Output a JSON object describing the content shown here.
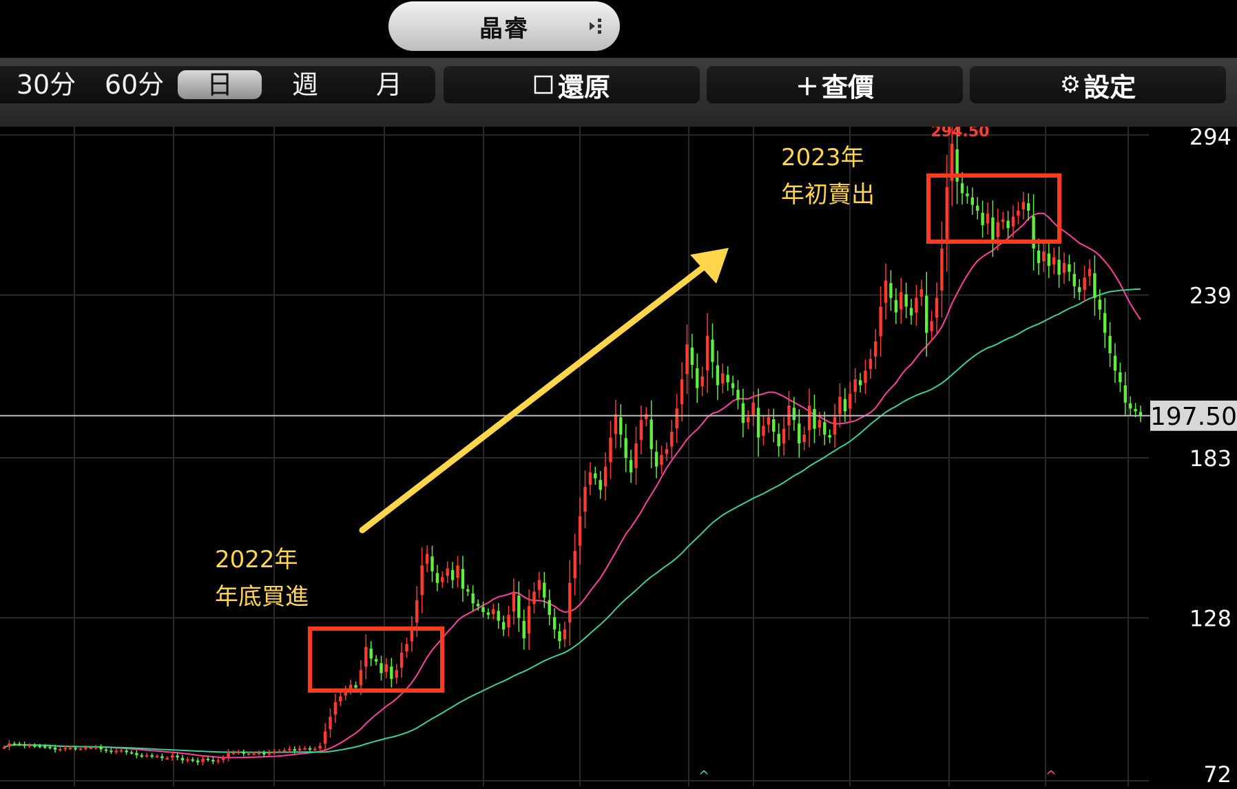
{
  "header": {
    "stock_name": "晶睿"
  },
  "toolbar": {
    "periods": [
      "30分",
      "60分",
      "日",
      "週",
      "月"
    ],
    "selected_period": "日",
    "restore_label": "還原",
    "add_quote_label": "查價",
    "settings_label": "設定"
  },
  "icons": {
    "menu": "kebab-menu-icon",
    "restore": "checkbox-icon",
    "add_quote": "plus-icon",
    "settings": "gear-icon"
  },
  "colors": {
    "up": "#ff3b30",
    "down": "#5ef03c",
    "ma_short": "#ff3ea5",
    "ma_long": "#34d399",
    "annotation": "#ffd54a",
    "box": "#ff3b1e",
    "price_line": "#bdbdbd",
    "grid": "#2a2a2a"
  },
  "chart_data": {
    "type": "candlestick",
    "y_ticks": [
      "294",
      "239",
      "183",
      "128",
      "72"
    ],
    "ylim": [
      72,
      294.5
    ],
    "current_price": "197.50",
    "high_label": "294.50",
    "annotations": [
      {
        "name": "buy",
        "lines": [
          "2022年",
          "年底買進"
        ]
      },
      {
        "name": "sell",
        "lines": [
          "2023年",
          "年初賣出"
        ]
      }
    ],
    "close": [
      83.5,
      84.8,
      84.7,
      84.6,
      84.0,
      84.2,
      84.0,
      83.9,
      83.7,
      83.5,
      82.7,
      82.9,
      83.3,
      83.3,
      83.1,
      83.1,
      83.4,
      83.4,
      83.6,
      82.8,
      82.4,
      82.0,
      82.3,
      82.5,
      81.8,
      81.7,
      80.8,
      80.6,
      80.8,
      80.5,
      80.5,
      79.8,
      79.8,
      80.8,
      80.0,
      79.0,
      79.4,
      79.1,
      78.3,
      79.6,
      79.3,
      78.6,
      79.0,
      79.8,
      81.5,
      81.7,
      81.9,
      81.3,
      81.4,
      81.4,
      81.6,
      81.0,
      81.7,
      82.1,
      82.2,
      82.5,
      83.0,
      82.3,
      83.1,
      83.2,
      82.9,
      83.0,
      84.0,
      89.0,
      94.0,
      99.0,
      101.0,
      103.0,
      105.0,
      104.0,
      110.0,
      118.0,
      114.0,
      113.0,
      109.0,
      112.0,
      107.0,
      110.0,
      116.0,
      119.0,
      125.0,
      134.0,
      146.0,
      150.0,
      144.0,
      140.0,
      142.0,
      145.0,
      141.0,
      146.0,
      138.0,
      137.0,
      133.0,
      132.0,
      130.0,
      129.0,
      131.0,
      127.0,
      124.0,
      129.0,
      137.0,
      128.0,
      121.0,
      132.0,
      137.0,
      141.0,
      135.0,
      129.0,
      124.0,
      120.0,
      124.0,
      140.0,
      151.0,
      163.0,
      173.0,
      178.0,
      176.0,
      172.0,
      180.0,
      190.0,
      198.0,
      191.0,
      183.0,
      178.0,
      188.0,
      196.0,
      198.0,
      186.0,
      180.0,
      184.0,
      186.0,
      192.0,
      200.0,
      210.0,
      222.0,
      215.0,
      207.0,
      211.0,
      225.0,
      216.0,
      208.0,
      212.0,
      209.0,
      207.0,
      203.0,
      195.0,
      197.0,
      202.0,
      190.0,
      194.0,
      197.0,
      192.0,
      187.0,
      193.0,
      201.0,
      196.0,
      188.0,
      191.0,
      201.0,
      193.0,
      196.0,
      191.0,
      190.0,
      197.0,
      204.0,
      199.0,
      205.0,
      210.0,
      208.0,
      213.0,
      217.0,
      223.0,
      235.0,
      244.0,
      238.0,
      233.0,
      240.0,
      235.0,
      232.0,
      238.0,
      241.0,
      226.0,
      230.0,
      238.0,
      255.0,
      276.0,
      291.0,
      278.0,
      274.0,
      273.0,
      270.0,
      268.0,
      263.0,
      267.0,
      258.0,
      264.0,
      265.0,
      262.0,
      266.0,
      268.0,
      271.0,
      268.0,
      255.0,
      250.0,
      254.0,
      249.0,
      252.0,
      246.0,
      250.0,
      247.0,
      242.0,
      240.0,
      245.0,
      248.0,
      238.0,
      234.0,
      226.0,
      219.0,
      213.0,
      209.0,
      202.0,
      200.0,
      199.0,
      197.5
    ]
  }
}
